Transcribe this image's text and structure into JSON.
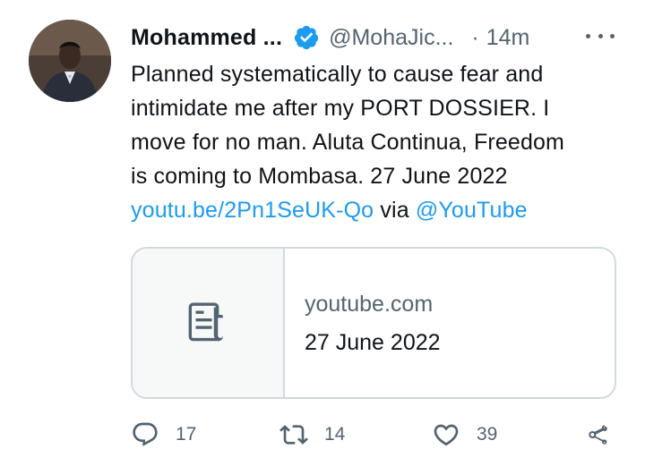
{
  "tweet": {
    "author_name": "Mohammed ...",
    "handle": "@MohaJic...",
    "separator": "·",
    "time": "14m",
    "text_lines": [
      "Planned systematically to cause fear and",
      "intimidate me after my PORT DOSSIER. I",
      "move for no man. Aluta Continua, Freedom",
      "is coming to Mombasa. 27 June 2022"
    ],
    "link_url": "youtu.be/2Pn1SeUK-Qo",
    "via_text": "via",
    "via_mention": "@YouTube"
  },
  "card": {
    "domain": "youtube.com",
    "title": "27 June 2022",
    "icon": "document-icon"
  },
  "actions": {
    "reply_count": "17",
    "retweet_count": "14",
    "like_count": "39",
    "icons": [
      "reply-icon",
      "retweet-icon",
      "like-icon",
      "share-icon"
    ]
  },
  "colors": {
    "link": "#1d9bf0",
    "secondary_text": "#536471",
    "primary_text": "#0f1419",
    "border": "#cfd9de",
    "verified": "#1d9bf0"
  }
}
